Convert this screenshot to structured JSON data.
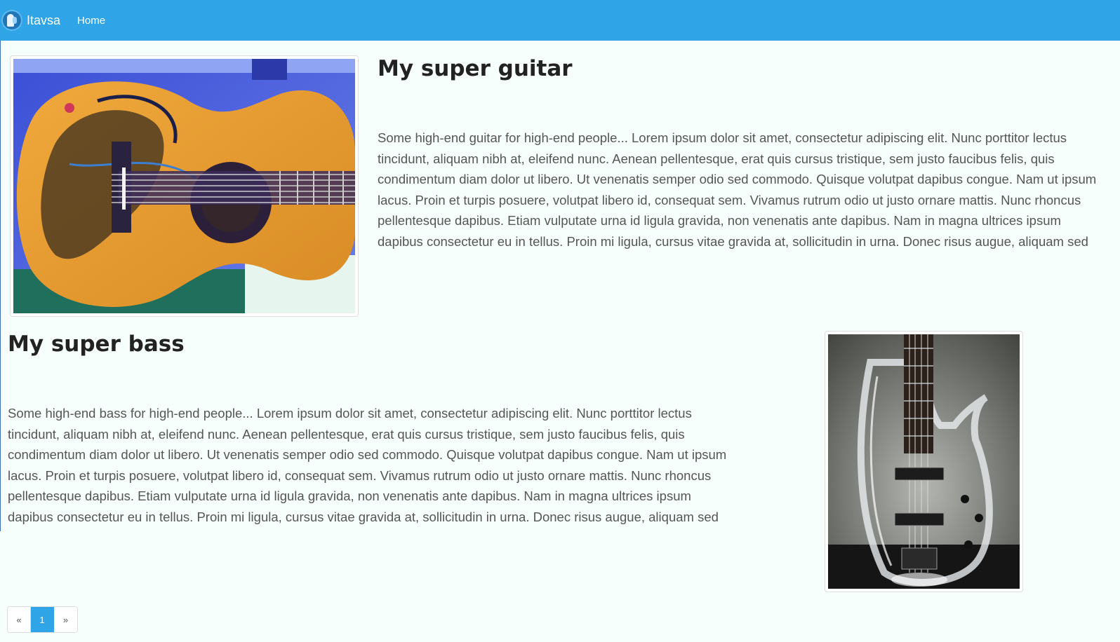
{
  "navbar": {
    "brand": "Itavsa",
    "links": [
      {
        "label": "Home"
      }
    ]
  },
  "products": [
    {
      "title": "My super guitar",
      "description": "Some high-end guitar for high-end people... Lorem ipsum dolor sit amet, consectetur adipiscing elit. Nunc porttitor lectus tincidunt, aliquam nibh at, eleifend nunc. Aenean pellentesque, erat quis cursus tristique, sem justo faucibus felis, quis condimentum diam dolor ut libero. Ut venenatis semper odio sed commodo. Quisque volutpat dapibus congue. Nam ut ipsum lacus. Proin et turpis posuere, volutpat libero id, consequat sem. Vivamus rutrum odio ut justo ornare mattis. Nunc rhoncus pellentesque dapibus. Etiam vulputate urna id ligula gravida, non venenatis ante dapibus. Nam in magna ultrices ipsum dapibus consectetur eu in tellus. Proin mi ligula, cursus vitae gravida at, sollicitudin in urna. Donec risus augue, aliquam sed pharetra et, faucibus id eros.",
      "image_icon": "guitar-photo"
    },
    {
      "title": "My super bass",
      "description": "Some high-end bass for high-end people... Lorem ipsum dolor sit amet, consectetur adipiscing elit. Nunc porttitor lectus tincidunt, aliquam nibh at, eleifend nunc. Aenean pellentesque, erat quis cursus tristique, sem justo faucibus felis, quis condimentum diam dolor ut libero. Ut venenatis semper odio sed commodo. Quisque volutpat dapibus congue. Nam ut ipsum lacus. Proin et turpis posuere, volutpat libero id, consequat sem. Vivamus rutrum odio ut justo ornare mattis. Nunc rhoncus pellentesque dapibus. Etiam vulputate urna id ligula gravida, non venenatis ante dapibus. Nam in magna ultrices ipsum dapibus consectetur eu in tellus. Proin mi ligula, cursus vitae gravida at, sollicitudin in urna. Donec risus augue, aliquam sed pharetra et, faucibus id eros.",
      "image_icon": "bass-photo"
    }
  ],
  "pagination": {
    "prev": "«",
    "current": "1",
    "next": "»"
  },
  "colors": {
    "navbar": "#2fa4e7",
    "background": "#f7fffd",
    "active_page": "#2fa4e7"
  }
}
